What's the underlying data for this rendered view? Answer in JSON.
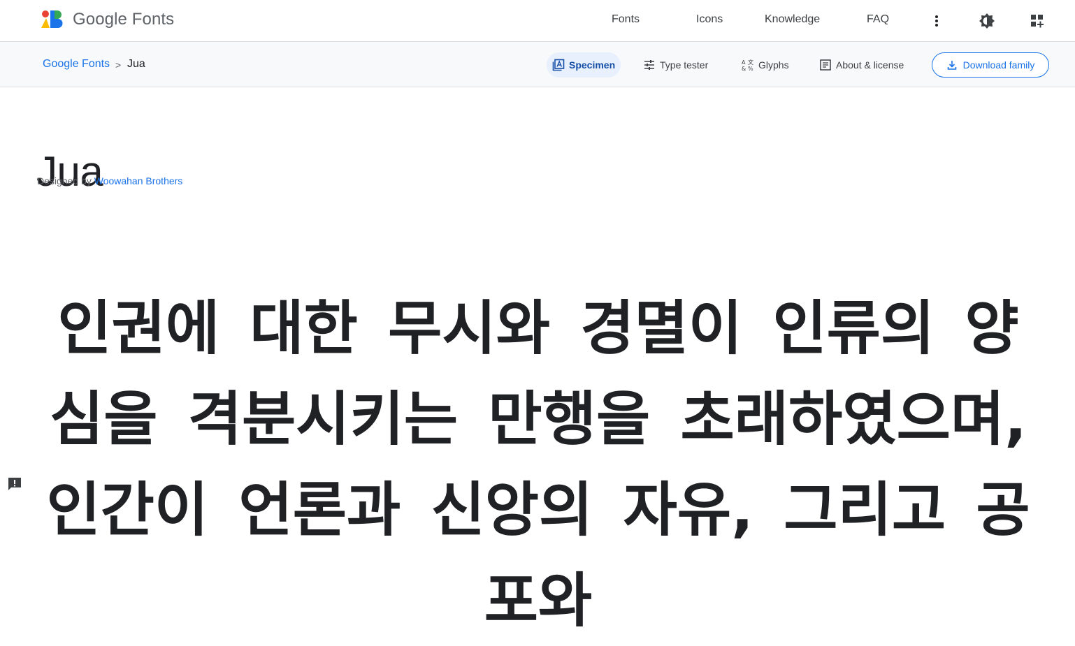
{
  "header": {
    "logo_text": "Google Fonts",
    "nav": [
      "Fonts",
      "Icons",
      "Knowledge",
      "FAQ"
    ],
    "icons": [
      "more-vert-icon",
      "theme-toggle-icon",
      "apps-add-icon"
    ]
  },
  "subnav": {
    "breadcrumb": {
      "root": "Google Fonts",
      "separator": ">",
      "current": "Jua"
    },
    "tabs": [
      "Specimen",
      "Type tester",
      "Glyphs",
      "About & license"
    ],
    "active_tab": "Specimen",
    "download_label": "Download family"
  },
  "font": {
    "name": "Jua",
    "designed_by_prefix": "Designed by",
    "designer": "Woowahan Brothers"
  },
  "specimen": {
    "text": "인권에 대한 무시와 경멸이 인류의 양심을 격분시키는 만행을 초래하였으며, 인간이 언론과 신앙의 자유, 그리고 공포와"
  },
  "colors": {
    "accent": "#1a73e8",
    "text": "#202124",
    "subnav_bg": "#f8f9fa",
    "active_tab_bg": "#e8f0fe"
  }
}
